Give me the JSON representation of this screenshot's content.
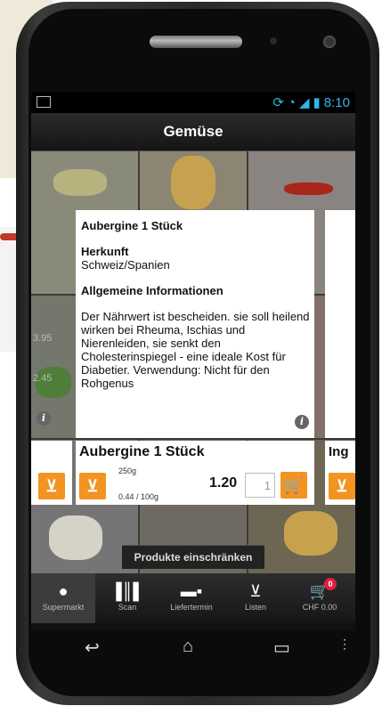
{
  "status": {
    "time": "8:10"
  },
  "header": {
    "title": "Gemüse"
  },
  "background_prices": {
    "left_1": "3.95",
    "left_2": "2.45"
  },
  "info": {
    "title": "Aubergine 1 Stück",
    "origin_label": "Herkunft",
    "origin_value": "Schweiz/Spanien",
    "general_label": "Allgemeine Informationen",
    "general_text": "Der Nährwert ist bescheiden. sie soll heilend wirken bei Rheuma, Ischias und Nierenleiden, sie senkt den Cholesterinspiegel - eine ideale Kost für Diabetier. Verwendung: Nicht für den Rohgenus"
  },
  "product": {
    "name": "Aubergine 1 Stück",
    "weight": "250g",
    "unit_price": "0.44 / 100g",
    "price": "1.20",
    "quantity": "1"
  },
  "side_product": {
    "name": "Ing"
  },
  "filter": {
    "label": "Produkte einschränken"
  },
  "tabs": [
    {
      "label": "Supermarkt",
      "icon": "apple-icon"
    },
    {
      "label": "Scan",
      "icon": "barcode-icon"
    },
    {
      "label": "Liefertermin",
      "icon": "truck-icon"
    },
    {
      "label": "Listen",
      "icon": "list-icon"
    },
    {
      "label": "CHF 0.00",
      "icon": "cart-icon",
      "badge": "0"
    }
  ],
  "colors": {
    "accent": "#f39322",
    "status": "#33b5e5",
    "badge": "#e0203a"
  }
}
